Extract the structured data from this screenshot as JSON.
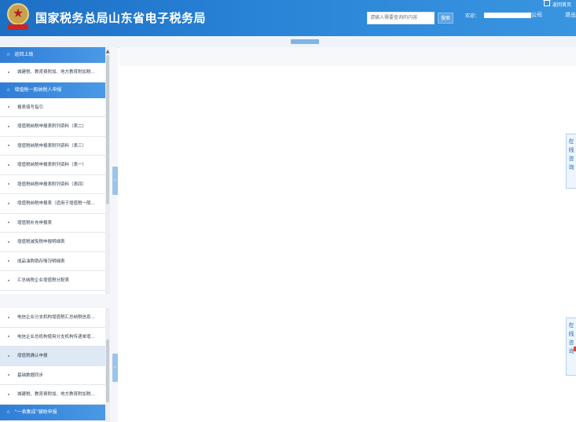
{
  "header": {
    "title": "国家税务总局山东省电子税务局",
    "search_placeholder": "请输入需要查询的内容",
    "search_button": "搜索",
    "welcome": "欢迎：",
    "company_suffix": "公司",
    "home": "返回首页",
    "exit": "退出"
  },
  "sidebar": {
    "sections": [
      {
        "header": "返回上级",
        "items": [
          "城建税、教育费附加、地方教育附加税..."
        ]
      },
      {
        "header": "增值税一般纳税人申报",
        "items": [
          "报表填写指引",
          "增值税纳税申报表附列资料（表二）",
          "增值税纳税申报表附列资料（表三）",
          "增值税纳税申报表附列资料（表一）",
          "增值税纳税申报表附列资料（表四）",
          "增值税纳税申报表（适用于增值税一般...",
          "增值税补充申报表",
          "增值税减免税申报明细表",
          "成品油购销存情况明细表",
          "汇总纳税企业增值税分配表"
        ]
      }
    ],
    "lower_items": [
      "电信企业分支机构增值税汇总纳税信息...",
      "电信企业总机构使用分支机构传递单增...",
      "增值税确认申报",
      "基础数据同步",
      "城建税、教育费附加、地方教育附加税..."
    ],
    "lower_section_header": "“一表集成”辅助申报"
  },
  "floating": {
    "top_label": "在线咨询",
    "bottom_label": "在线咨询"
  }
}
